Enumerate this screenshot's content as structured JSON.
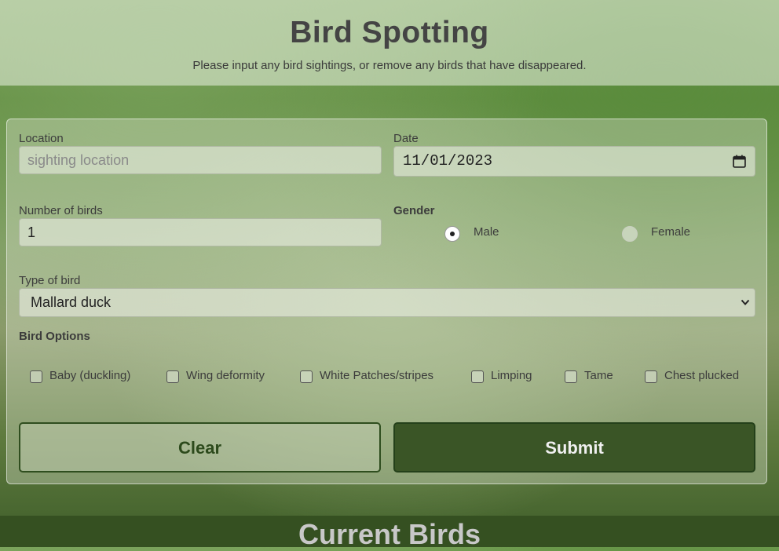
{
  "header": {
    "title": "Bird Spotting",
    "subtitle": "Please input any bird sightings, or remove any birds that have disappeared."
  },
  "form": {
    "location_label": "Location",
    "location_placeholder": "sighting location",
    "location_value": "",
    "date_label": "Date",
    "date_value": "11/01/2023",
    "count_label": "Number of birds",
    "count_value": "1",
    "gender_label": "Gender",
    "gender_options": [
      {
        "label": "Male",
        "selected": true
      },
      {
        "label": "Female",
        "selected": false
      }
    ],
    "type_label": "Type of bird",
    "type_selected": "Mallard duck",
    "options_label": "Bird Options",
    "options": [
      {
        "label": "Baby (duckling)",
        "checked": false
      },
      {
        "label": "Wing deformity",
        "checked": false
      },
      {
        "label": "White Patches/stripes",
        "checked": false
      },
      {
        "label": "Limping",
        "checked": false
      },
      {
        "label": "Tame",
        "checked": false
      },
      {
        "label": "Chest plucked",
        "checked": false
      }
    ],
    "clear_label": "Clear",
    "submit_label": "Submit"
  },
  "current": {
    "title": "Current Birds"
  },
  "colors": {
    "accent": "#3a5526",
    "footer_bg": "#355021"
  },
  "icons": {
    "date": "calendar-icon",
    "select": "chevron-down-icon"
  }
}
